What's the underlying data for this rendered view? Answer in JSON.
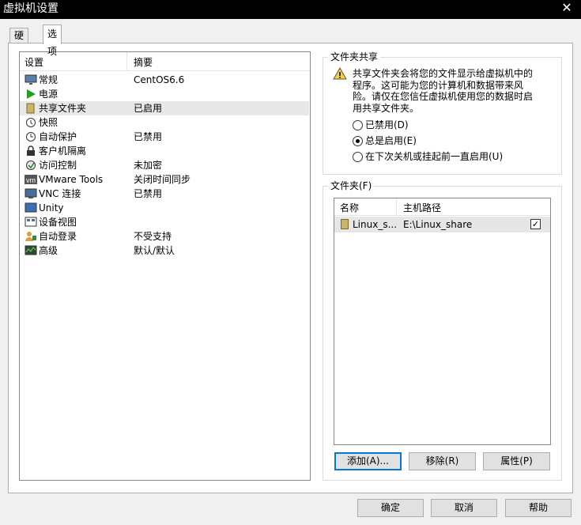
{
  "window": {
    "title": "虚拟机设置",
    "close_glyph": "✕"
  },
  "tabs": [
    {
      "label": "硬件"
    },
    {
      "label": "选项"
    }
  ],
  "settings": {
    "header": {
      "col1": "设置",
      "col2": "摘要"
    },
    "items": [
      {
        "label": "常规",
        "summary": "CentOS6.6",
        "icon": "monitor-icon"
      },
      {
        "label": "电源",
        "summary": "",
        "icon": "play-icon"
      },
      {
        "label": "共享文件夹",
        "summary": "已启用",
        "icon": "shared-folder-icon"
      },
      {
        "label": "快照",
        "summary": "",
        "icon": "snapshot-icon"
      },
      {
        "label": "自动保护",
        "summary": "已禁用",
        "icon": "autoprotect-icon"
      },
      {
        "label": "客户机隔离",
        "summary": "",
        "icon": "lock-icon"
      },
      {
        "label": "访问控制",
        "summary": "未加密",
        "icon": "access-control-icon"
      },
      {
        "label": "VMware Tools",
        "summary": "关闭时间同步",
        "icon": "vm-icon"
      },
      {
        "label": "VNC 连接",
        "summary": "已禁用",
        "icon": "vnc-icon"
      },
      {
        "label": "Unity",
        "summary": "",
        "icon": "unity-icon"
      },
      {
        "label": "设备视图",
        "summary": "",
        "icon": "device-view-icon"
      },
      {
        "label": "自动登录",
        "summary": "不受支持",
        "icon": "autologin-icon"
      },
      {
        "label": "高级",
        "summary": "默认/默认",
        "icon": "advanced-icon"
      }
    ]
  },
  "sharing": {
    "title": "文件夹共享",
    "warning": "共享文件夹会将您的文件显示给虚拟机中的程序。这可能为您的计算机和数据带来风险。请仅在您信任虚拟机使用您的数据时启用共享文件夹。",
    "options": [
      {
        "label": "已禁用(D)",
        "selected": false
      },
      {
        "label": "总是启用(E)",
        "selected": true
      },
      {
        "label": "在下次关机或挂起前一直启用(U)",
        "selected": false
      }
    ]
  },
  "folders": {
    "title": "文件夹(F)",
    "header": {
      "name": "名称",
      "path": "主机路径"
    },
    "rows": [
      {
        "name": "Linux_s...",
        "path": "E:\\Linux_share",
        "checked": true,
        "check_glyph": "✓"
      }
    ],
    "buttons": {
      "add": "添加(A)...",
      "remove": "移除(R)",
      "properties": "属性(P)"
    }
  },
  "footer": {
    "ok": "确定",
    "cancel": "取消",
    "help": "帮助"
  }
}
